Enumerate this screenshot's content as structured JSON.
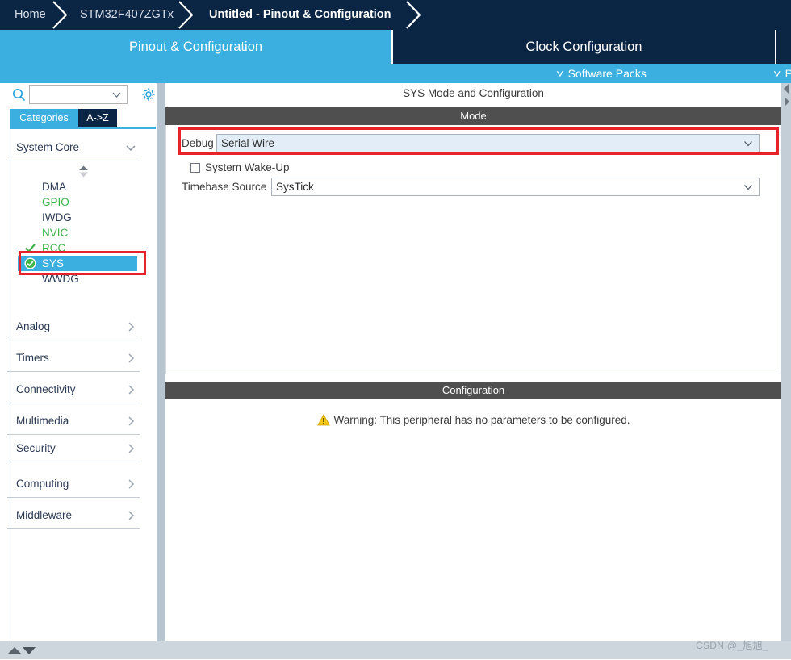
{
  "breadcrumb": {
    "items": [
      {
        "label": "Home",
        "active": false
      },
      {
        "label": "STM32F407ZGTx",
        "active": false
      },
      {
        "label": "Untitled - Pinout & Configuration",
        "active": true
      }
    ]
  },
  "tabs": [
    {
      "label": "Pinout & Configuration",
      "state": "active"
    },
    {
      "label": "Clock Configuration",
      "state": "inactive"
    }
  ],
  "secondary_menu": [
    {
      "label": "Software Packs",
      "icon": "chevron-down-icon"
    },
    {
      "label": "P",
      "icon": "chevron-down-icon"
    }
  ],
  "sidebar": {
    "search": {
      "value": "",
      "placeholder": "",
      "icon": "search-icon",
      "dropdown_icon": "chevron-down-icon"
    },
    "settings_icon": "gear-icon",
    "view_tabs": [
      {
        "label": "Categories",
        "selected": true
      },
      {
        "label": "A->Z",
        "selected": false
      }
    ],
    "groups": [
      {
        "label": "System Core",
        "expanded": true,
        "icon": "chevron-down-icon"
      },
      {
        "label": "Analog",
        "expanded": false,
        "icon": "chevron-right-icon"
      },
      {
        "label": "Timers",
        "expanded": false,
        "icon": "chevron-right-icon"
      },
      {
        "label": "Connectivity",
        "expanded": false,
        "icon": "chevron-right-icon"
      },
      {
        "label": "Multimedia",
        "expanded": false,
        "icon": "chevron-right-icon"
      },
      {
        "label": "Security",
        "expanded": false,
        "icon": "chevron-right-icon"
      },
      {
        "label": "Computing",
        "expanded": false,
        "icon": "chevron-right-icon"
      },
      {
        "label": "Middleware",
        "expanded": false,
        "icon": "chevron-right-icon"
      }
    ],
    "peripherals": [
      {
        "label": "DMA",
        "color": "dark",
        "status": "none",
        "selected": false
      },
      {
        "label": "GPIO",
        "color": "green",
        "status": "none",
        "selected": false
      },
      {
        "label": "IWDG",
        "color": "dark",
        "status": "none",
        "selected": false
      },
      {
        "label": "NVIC",
        "color": "green",
        "status": "none",
        "selected": false
      },
      {
        "label": "RCC",
        "color": "green",
        "status": "check",
        "selected": false
      },
      {
        "label": "SYS",
        "color": "white",
        "status": "check-circle",
        "selected": true
      },
      {
        "label": "WWDG",
        "color": "dark",
        "status": "none",
        "selected": false
      }
    ]
  },
  "main": {
    "title": "SYS Mode and Configuration",
    "mode_band": "Mode",
    "config_band": "Configuration",
    "fields": {
      "debug_label": "Debug",
      "debug_value": "Serial Wire",
      "wakeup_label": "System Wake-Up",
      "wakeup_checked": false,
      "timebase_label": "Timebase Source",
      "timebase_value": "SysTick"
    },
    "warning": {
      "icon": "warning-triangle-icon",
      "text": "Warning: This peripheral has no parameters to be configured."
    }
  },
  "watermark": "CSDN @_旭旭_",
  "colors": {
    "accent_blue": "#3aafe0",
    "navy": "#0b2545",
    "band_grey": "#4f4f4f",
    "peripheral_green": "#3cb44a",
    "highlight_red": "#e8222a",
    "warning_yellow": "#f5c518",
    "combo_tint": "#e2edf7"
  }
}
